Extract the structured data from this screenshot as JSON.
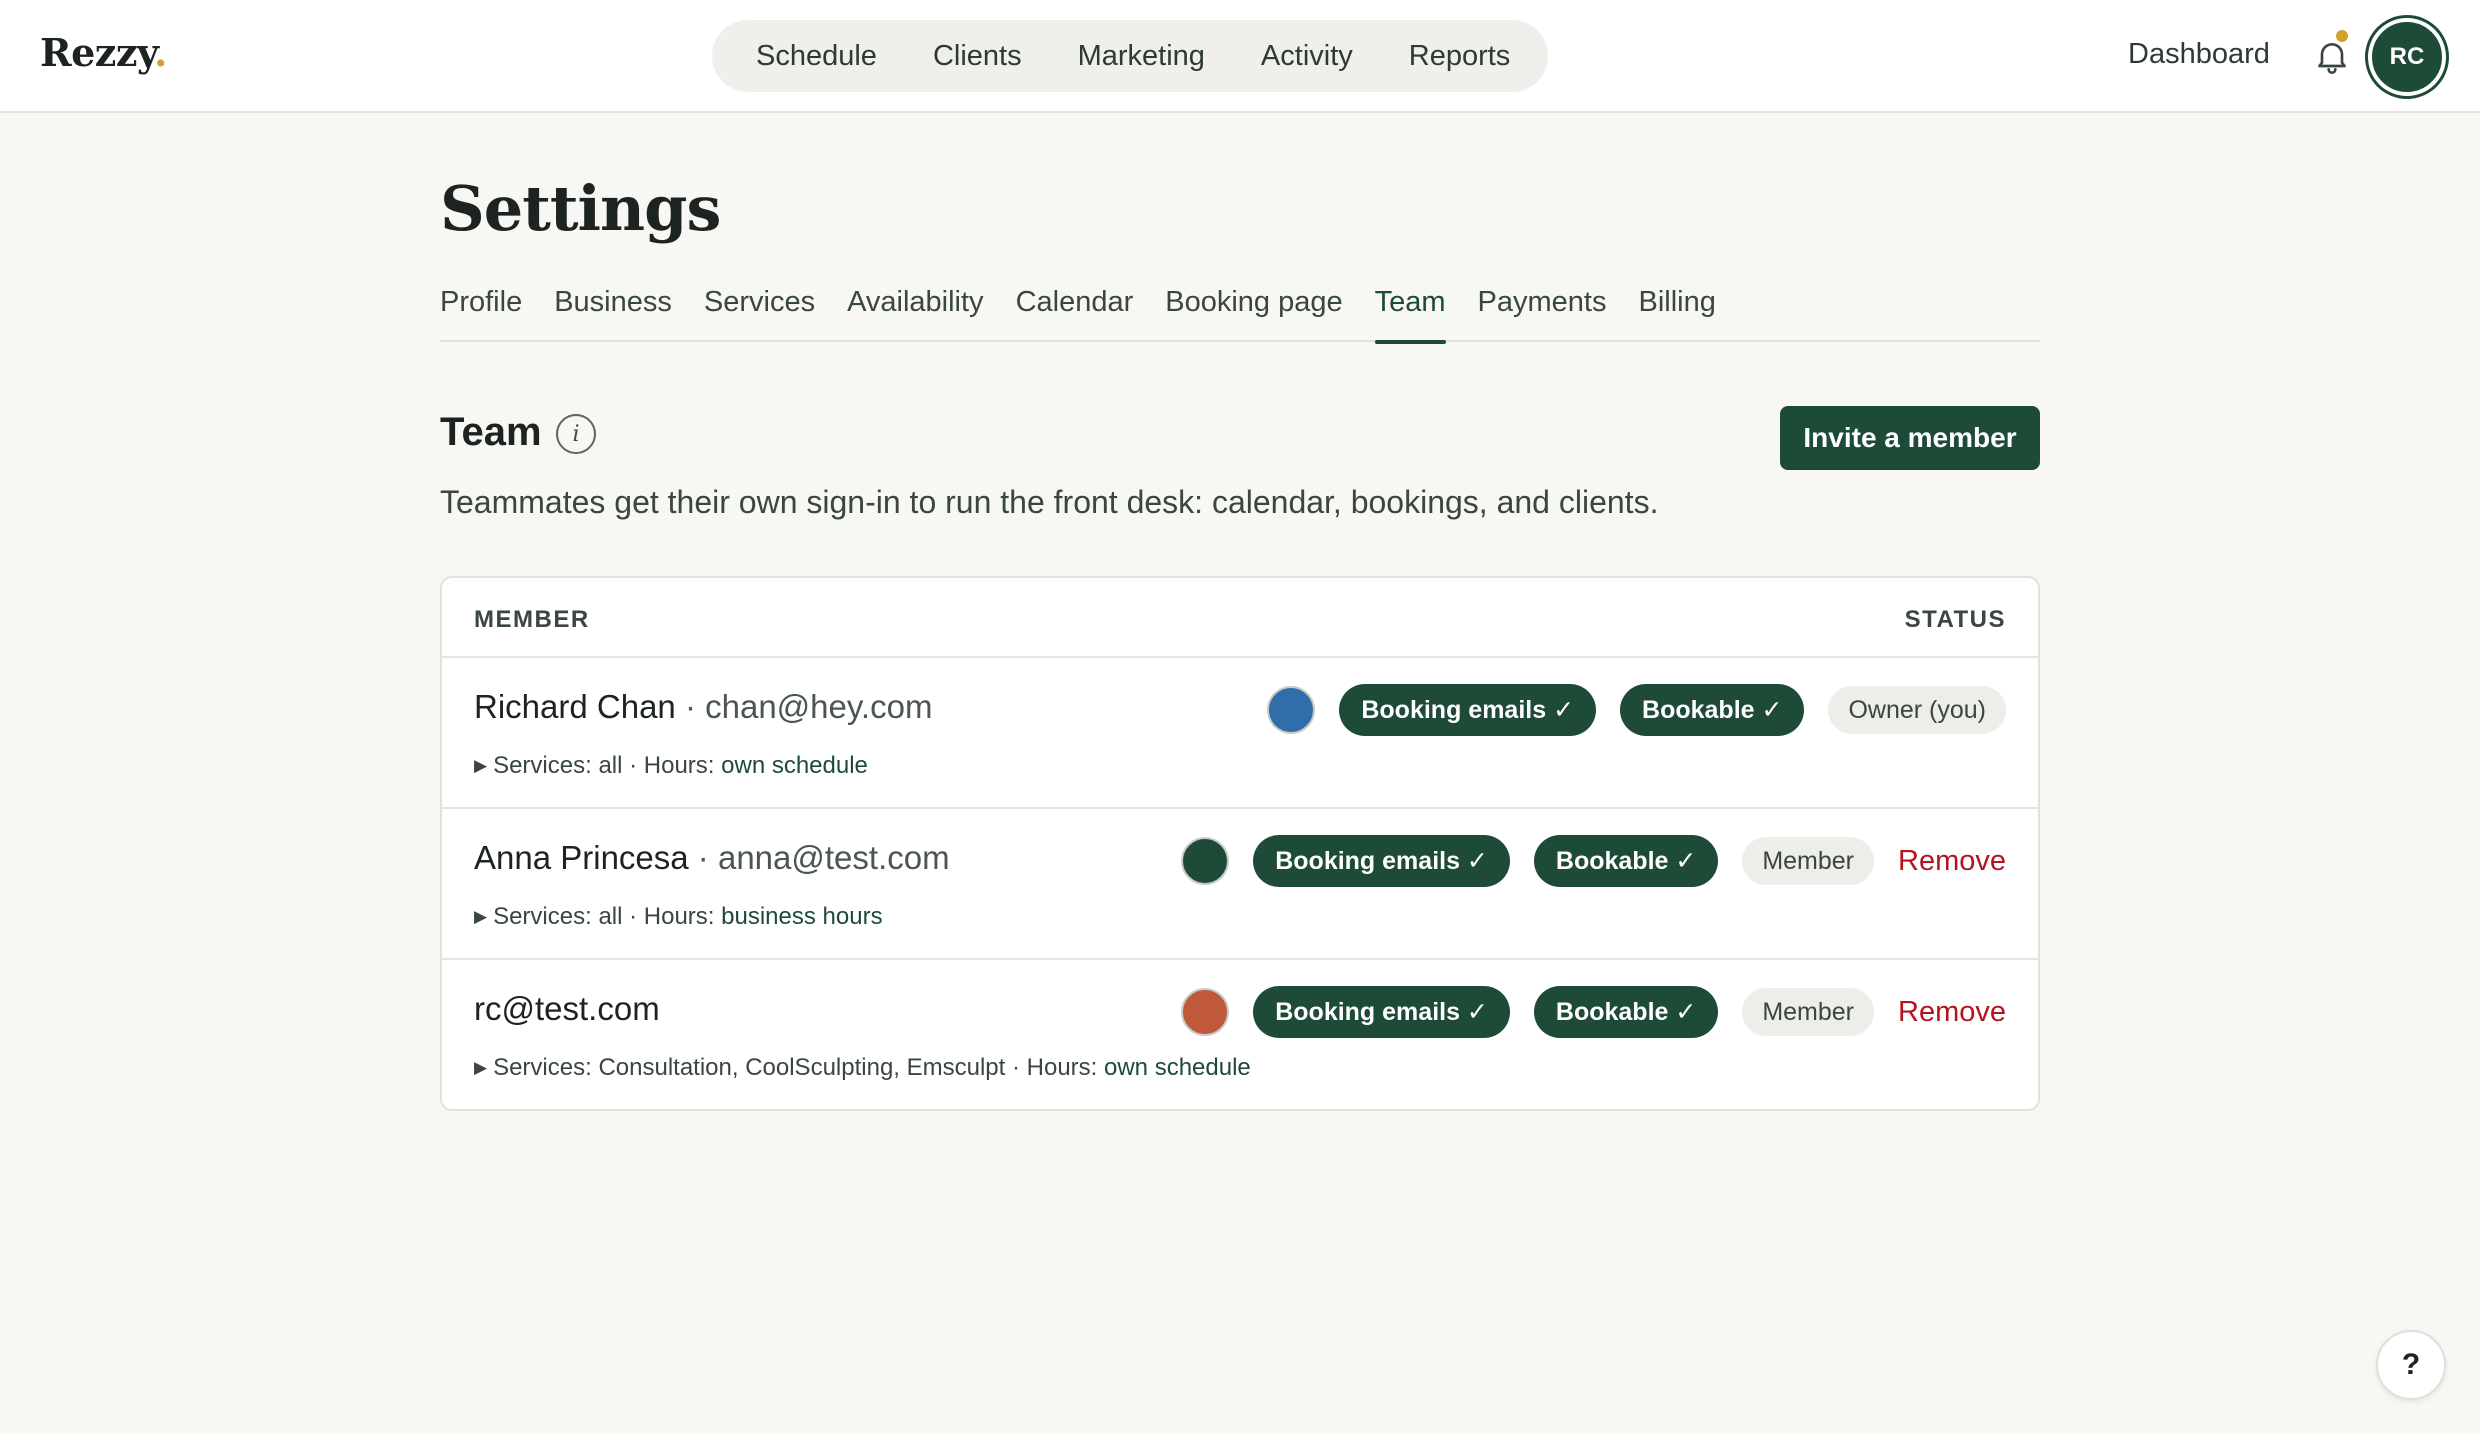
{
  "app": {
    "logo": "Rezzy",
    "logo_dot": "."
  },
  "nav": {
    "items": [
      "Schedule",
      "Clients",
      "Marketing",
      "Activity",
      "Reports"
    ],
    "dashboard": "Dashboard",
    "avatar_initials": "RC",
    "notification_icon": "bell-icon",
    "notification_dot_color": "#d4a02a"
  },
  "page": {
    "title": "Settings",
    "tabs": [
      "Profile",
      "Business",
      "Services",
      "Availability",
      "Calendar",
      "Booking page",
      "Team",
      "Payments",
      "Billing"
    ],
    "active_tab": "Team"
  },
  "team": {
    "title": "Team",
    "info_icon": "i",
    "invite_label": "Invite a member",
    "description": "Teammates get their own sign-in to run the front desk: calendar, bookings, and clients.",
    "columns": {
      "member": "MEMBER",
      "status": "STATUS"
    },
    "members": [
      {
        "name": "Richard Chan",
        "separator": " · ",
        "email": "chan@hey.com",
        "services_label": "Services: all · Hours: ",
        "hours": "own schedule",
        "color": "#2f6ea8",
        "booking_emails": "Booking emails ✓",
        "bookable": "Bookable ✓",
        "role": "Owner (you)",
        "remove": ""
      },
      {
        "name": "Anna Princesa",
        "separator": " · ",
        "email": "anna@test.com",
        "services_label": "Services: all · Hours: ",
        "hours": "business hours",
        "color": "#1e4a38",
        "booking_emails": "Booking emails ✓",
        "bookable": "Bookable ✓",
        "role": "Member",
        "remove": "Remove"
      },
      {
        "name": "rc@test.com",
        "separator": "",
        "email": "",
        "services_label": "Services: Consultation, CoolSculpting, Emsculpt · Hours: ",
        "hours": "own schedule",
        "color": "#c0583a",
        "booking_emails": "Booking emails ✓",
        "bookable": "Bookable ✓",
        "role": "Member",
        "remove": "Remove"
      }
    ]
  },
  "help": {
    "label": "?"
  },
  "colors": {
    "brand": "#1e4a38",
    "danger": "#b3151f",
    "accent": "#d4a02a"
  }
}
